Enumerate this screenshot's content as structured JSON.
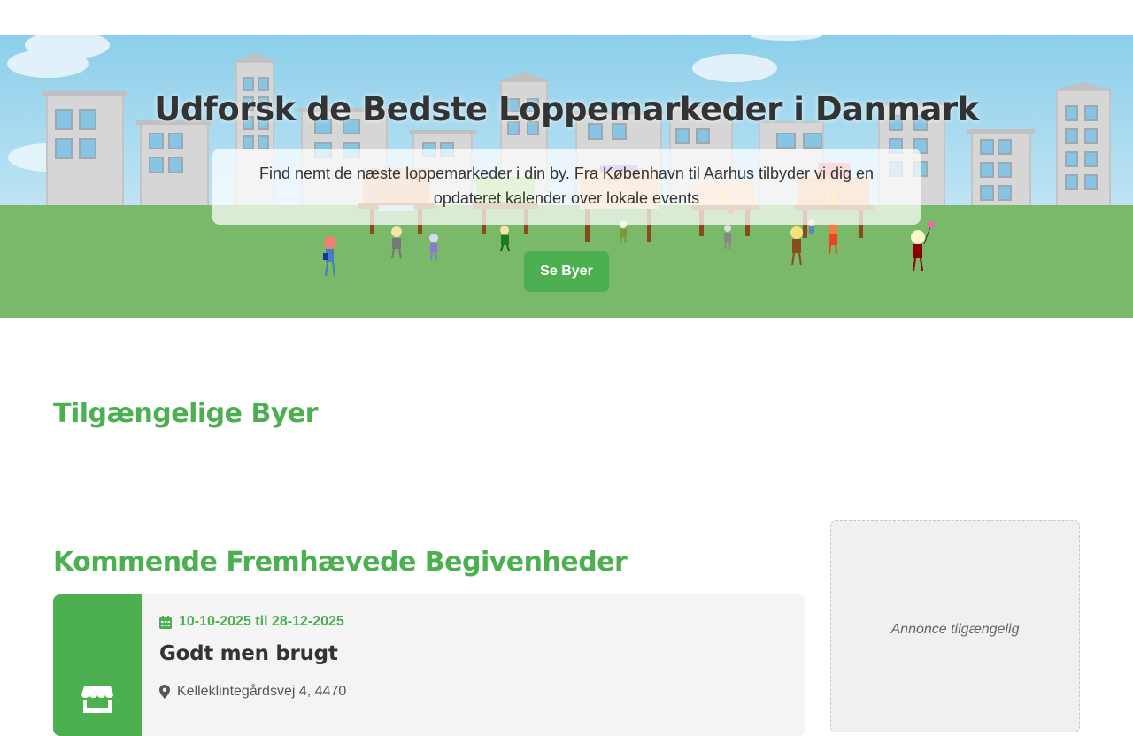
{
  "hero": {
    "title": "Udforsk de Bedste Loppemarkeder i Danmark",
    "subtitle": "Find nemt de næste loppemarkeder i din by. Fra København til Aarhus tilbyder vi dig en opdateret kalender over lokale events",
    "button_label": "Se Byer"
  },
  "cities_section": {
    "title": "Tilgængelige Byer"
  },
  "events_section": {
    "title": "Kommende Fremhævede Begivenheder",
    "events": [
      {
        "date_range": "10-10-2025 til 28-12-2025",
        "name": "Godt men brugt",
        "address": "Kelleklintegårdsvej 4, 4470",
        "icon": "store-icon",
        "date_icon": "calendar-icon",
        "address_icon": "map-pin-icon"
      }
    ]
  },
  "ad": {
    "label": "Annonce tilgængelig"
  },
  "colors": {
    "accent": "#4caf50",
    "grass": "#7ab86a",
    "sky": "#8ccfea",
    "text": "#333333"
  }
}
